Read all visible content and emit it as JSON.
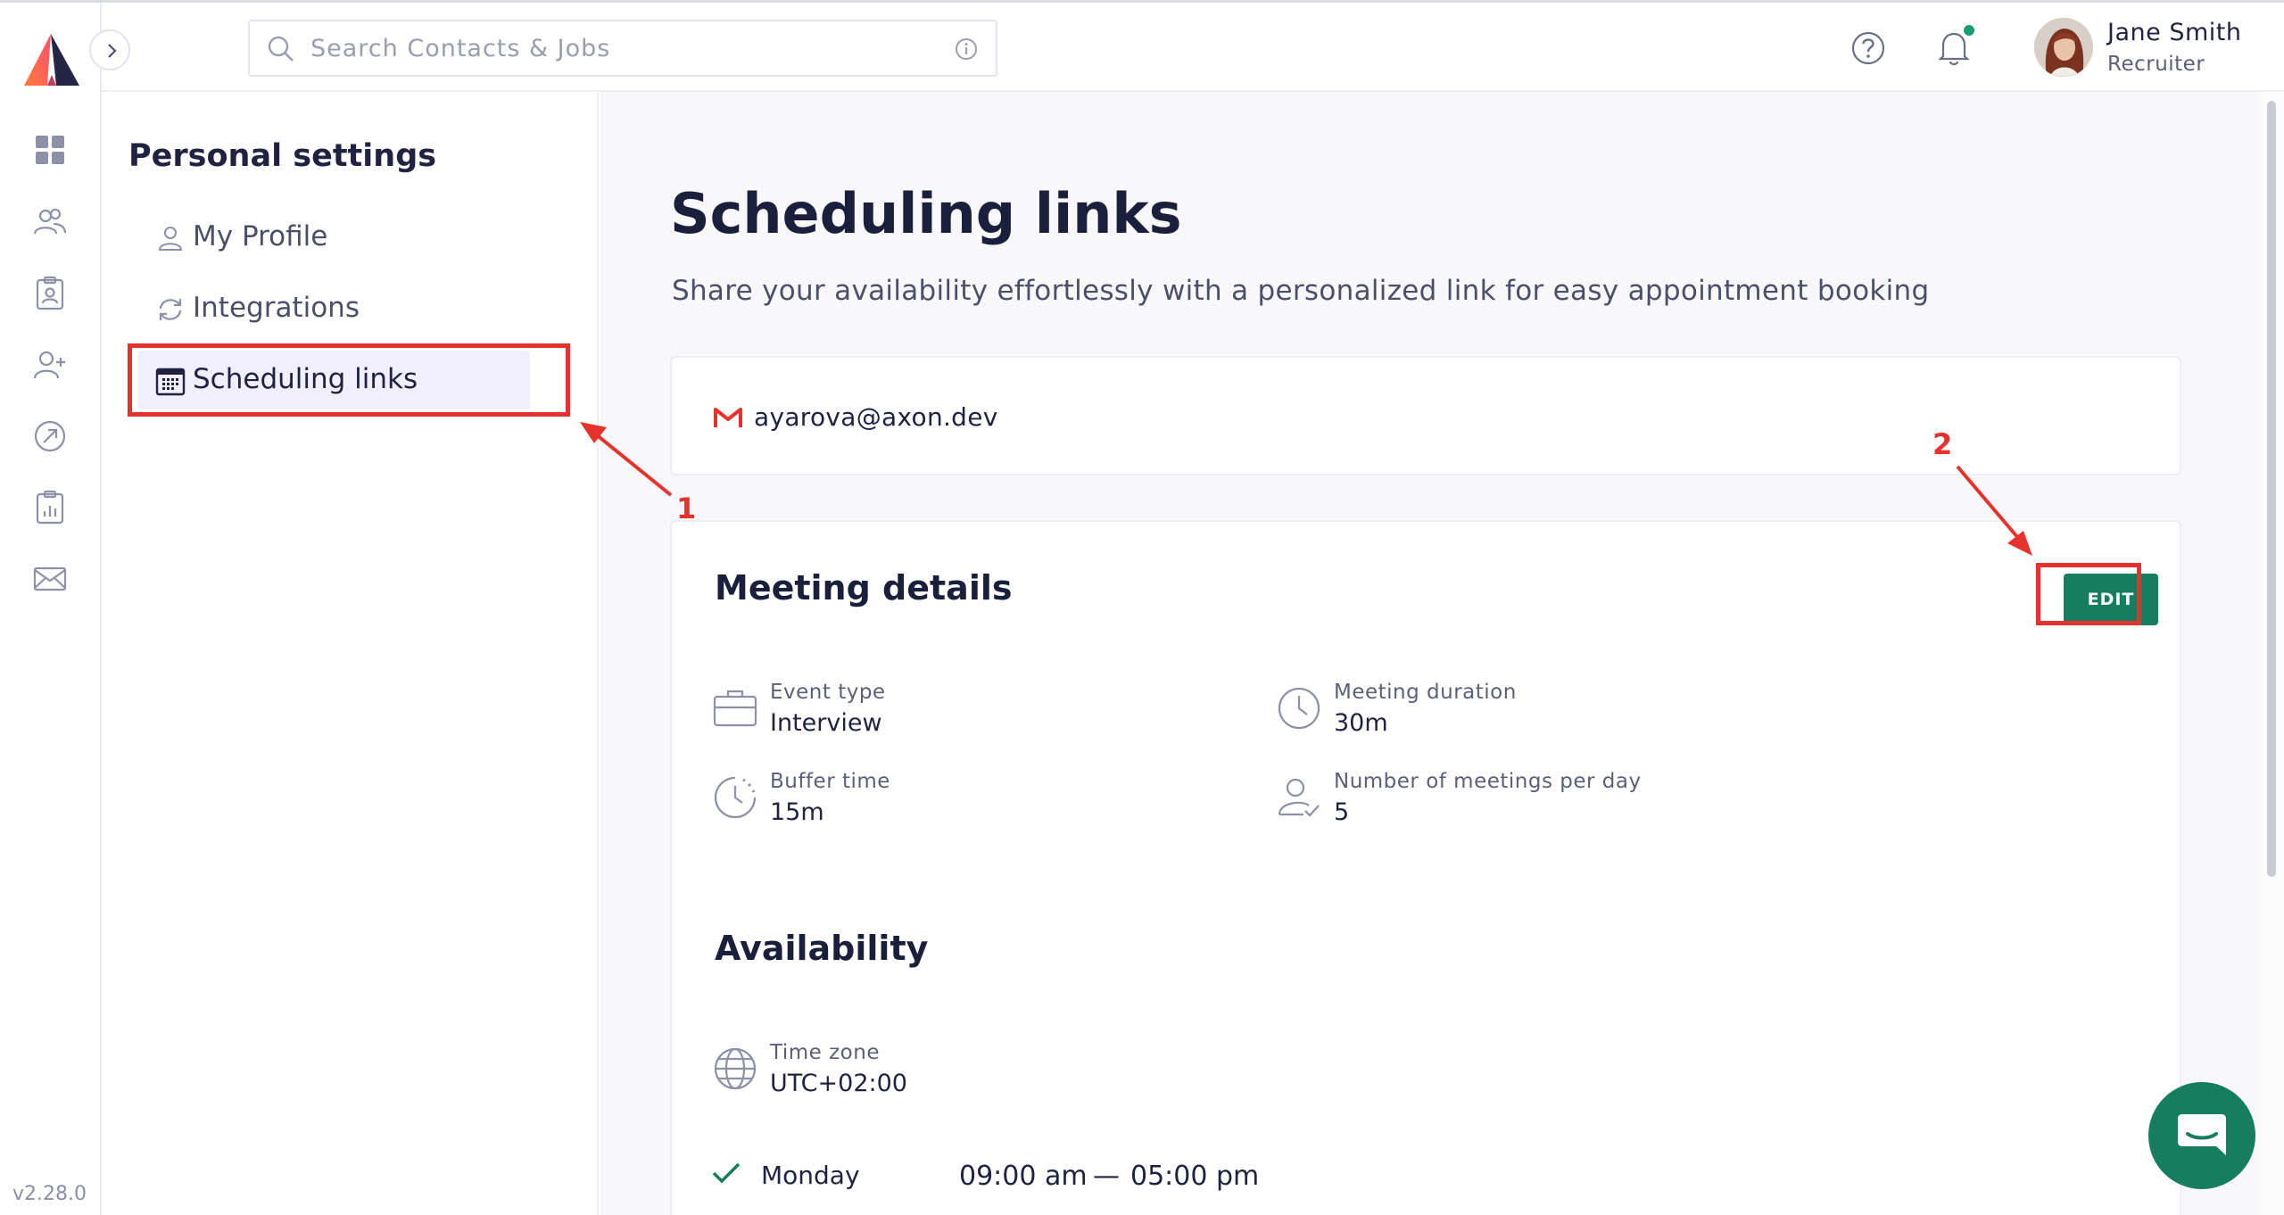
{
  "app": {
    "version": "v2.28.0"
  },
  "header": {
    "search_placeholder": "Search Contacts & Jobs",
    "user": {
      "name": "Jane Smith",
      "role": "Recruiter"
    }
  },
  "rail": {
    "icons": [
      "dashboard-icon",
      "contacts-icon",
      "jobs-icon",
      "add-user-icon",
      "analytics-icon",
      "reports-icon",
      "mail-icon"
    ]
  },
  "settings_nav": {
    "heading": "Personal settings",
    "items": [
      {
        "label": "My Profile",
        "icon": "user-icon"
      },
      {
        "label": "Integrations",
        "icon": "sync-icon"
      },
      {
        "label": "Scheduling links",
        "icon": "calendar-icon",
        "active": true
      }
    ]
  },
  "main": {
    "title": "Scheduling links",
    "subtitle": "Share your availability effortlessly with a personalized link for easy appointment booking",
    "email": "ayarova@axon.dev",
    "meeting_details": {
      "title": "Meeting details",
      "edit_label": "EDIT",
      "fields": [
        {
          "label": "Event type",
          "value": "Interview",
          "icon": "briefcase-icon"
        },
        {
          "label": "Meeting duration",
          "value": "30m",
          "icon": "clock-icon"
        },
        {
          "label": "Buffer time",
          "value": "15m",
          "icon": "buffer-clock-icon"
        },
        {
          "label": "Number of meetings per day",
          "value": "5",
          "icon": "user-check-icon"
        }
      ]
    },
    "availability": {
      "title": "Availability",
      "timezone_label": "Time zone",
      "timezone_value": "UTC+02:00",
      "days": [
        {
          "day": "Monday",
          "from": "09:00 am",
          "dash": "—",
          "to": "05:00 pm",
          "enabled": true
        }
      ]
    }
  },
  "annotations": {
    "step1": "1",
    "step2": "2",
    "color": "#e5322d"
  },
  "colors": {
    "accent": "#177d5f",
    "active_bg": "#f1eefd",
    "annotation": "#e5322d"
  }
}
